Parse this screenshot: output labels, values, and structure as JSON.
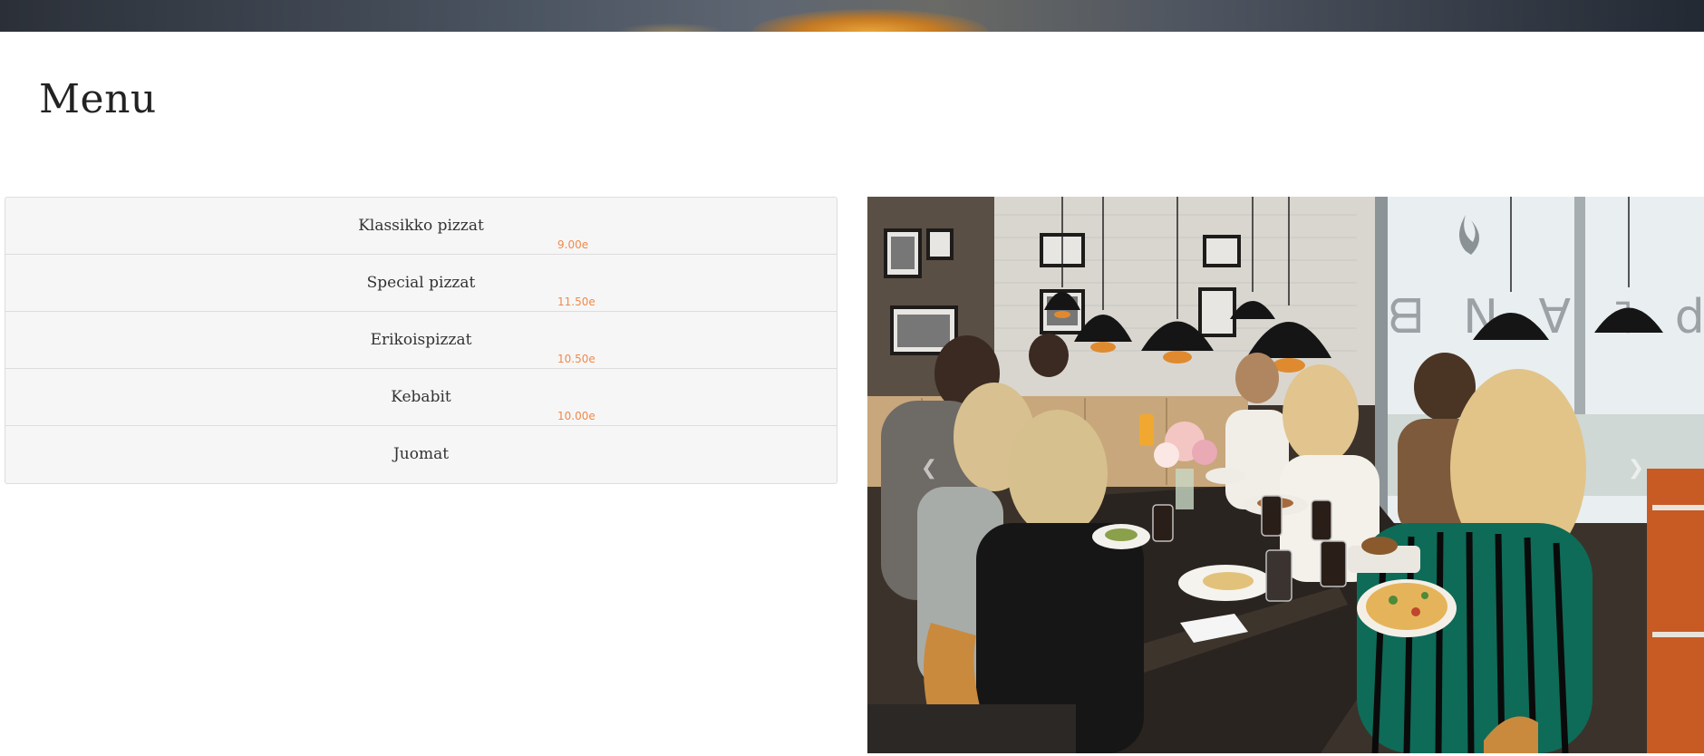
{
  "page": {
    "title": "Menu"
  },
  "menu": {
    "items": [
      {
        "name": "Klassikko pizzat",
        "price": "9.00e"
      },
      {
        "name": "Special pizzat",
        "price": "11.50e"
      },
      {
        "name": "Erikoispizzat",
        "price": "10.50e"
      },
      {
        "name": "Kebabit",
        "price": "10.00e"
      },
      {
        "name": "Juomat",
        "price": ""
      }
    ]
  },
  "carousel": {
    "prev_icon": "chevron-left-icon",
    "next_icon": "chevron-right-icon",
    "prev_glyph": "❮",
    "next_glyph": "❯",
    "sign_text": "PLAN B"
  },
  "colors": {
    "price_accent": "#f08a4b",
    "title": "#222222",
    "list_bg": "#f6f6f6",
    "list_border": "#dddddd"
  }
}
